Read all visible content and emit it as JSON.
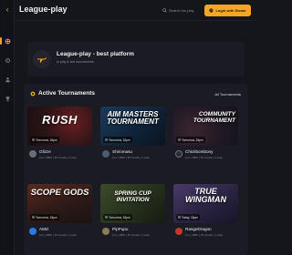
{
  "app": {
    "title": "League-play"
  },
  "header": {
    "search_placeholder": "Search ion play",
    "login_label": "Login with Steam"
  },
  "platform": {
    "title": "League-play - best platform",
    "subtitle": "to play & see tournaments"
  },
  "tournaments": {
    "title": "Active Tournaments",
    "all_link": "All Tournaments",
    "cards": [
      {
        "banner": "RUSH",
        "date": "Tomorrow, 18pm",
        "host": "Glizze",
        "meta": "1v1 | 1800 | 15 rounds | 1 map"
      },
      {
        "banner": "AIM MASTERS TOURNAMENT",
        "date": "Tomorrow, 18pm",
        "host": "Shiromasu",
        "meta": "1v1 | 1800 | 15 rounds | 1 map"
      },
      {
        "banner": "COMMUNITY TOURNAMENT",
        "date": "Tomorrow, 18pm",
        "host": "Chickbombony",
        "meta": "1v1 | 1800 | 15 rounds | 1 map"
      },
      {
        "banner": "SCOPE GODS",
        "date": "Tomorrow, 18pm",
        "host": "AMG",
        "meta": "1v1 | 1800 | 15 rounds | 1 map"
      },
      {
        "banner": "SPRING CUP INVITATION",
        "date": "Tomorrow, 18pm",
        "host": "PipPupu",
        "meta": "1v1 | 1800 | 15 rounds | 1 map"
      },
      {
        "banner": "TRUE WINGMAN",
        "date": "Today, 18pm",
        "host": "RangeDragon",
        "meta": "1v1 | 1800 | 15 rounds | 1 map"
      }
    ]
  },
  "colors": {
    "accent": "#f5a623",
    "background": "#15161c",
    "panel": "#1b1c23"
  },
  "icons": {
    "sidebar": [
      "logo-icon",
      "home-icon",
      "settings-icon",
      "users-icon",
      "trophy-icon"
    ]
  }
}
